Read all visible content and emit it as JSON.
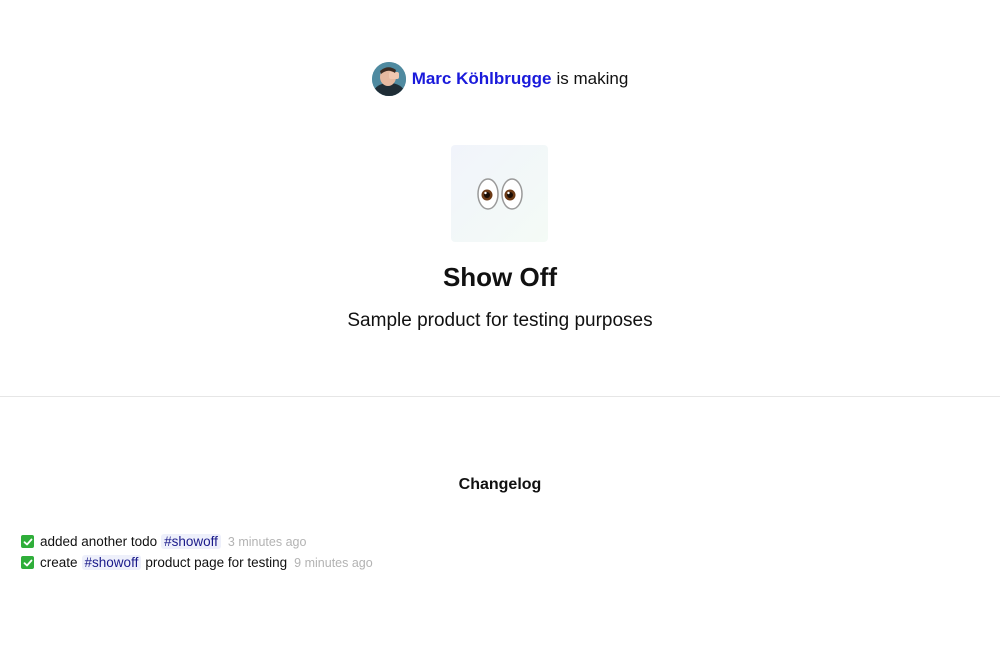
{
  "maker": {
    "name": "Marc Köhlbrugge",
    "suffix": "is making"
  },
  "product": {
    "logo_icon": "eyes-emoji-icon",
    "title": "Show Off",
    "description": "Sample product for testing purposes"
  },
  "changelog": {
    "heading": "Changelog",
    "items": [
      {
        "icon": "check-mark-icon",
        "text_before": "added another todo",
        "tag": "#showoff",
        "text_after": "",
        "time": "3 minutes ago"
      },
      {
        "icon": "check-mark-icon",
        "text_before": "create",
        "tag": "#showoff",
        "text_after": "product page for testing",
        "time": "9 minutes ago"
      }
    ]
  },
  "colors": {
    "link": "#1a1adb",
    "check": "#2fae3a",
    "muted": "#b3b3b3",
    "tag_bg": "#eef0fb"
  }
}
